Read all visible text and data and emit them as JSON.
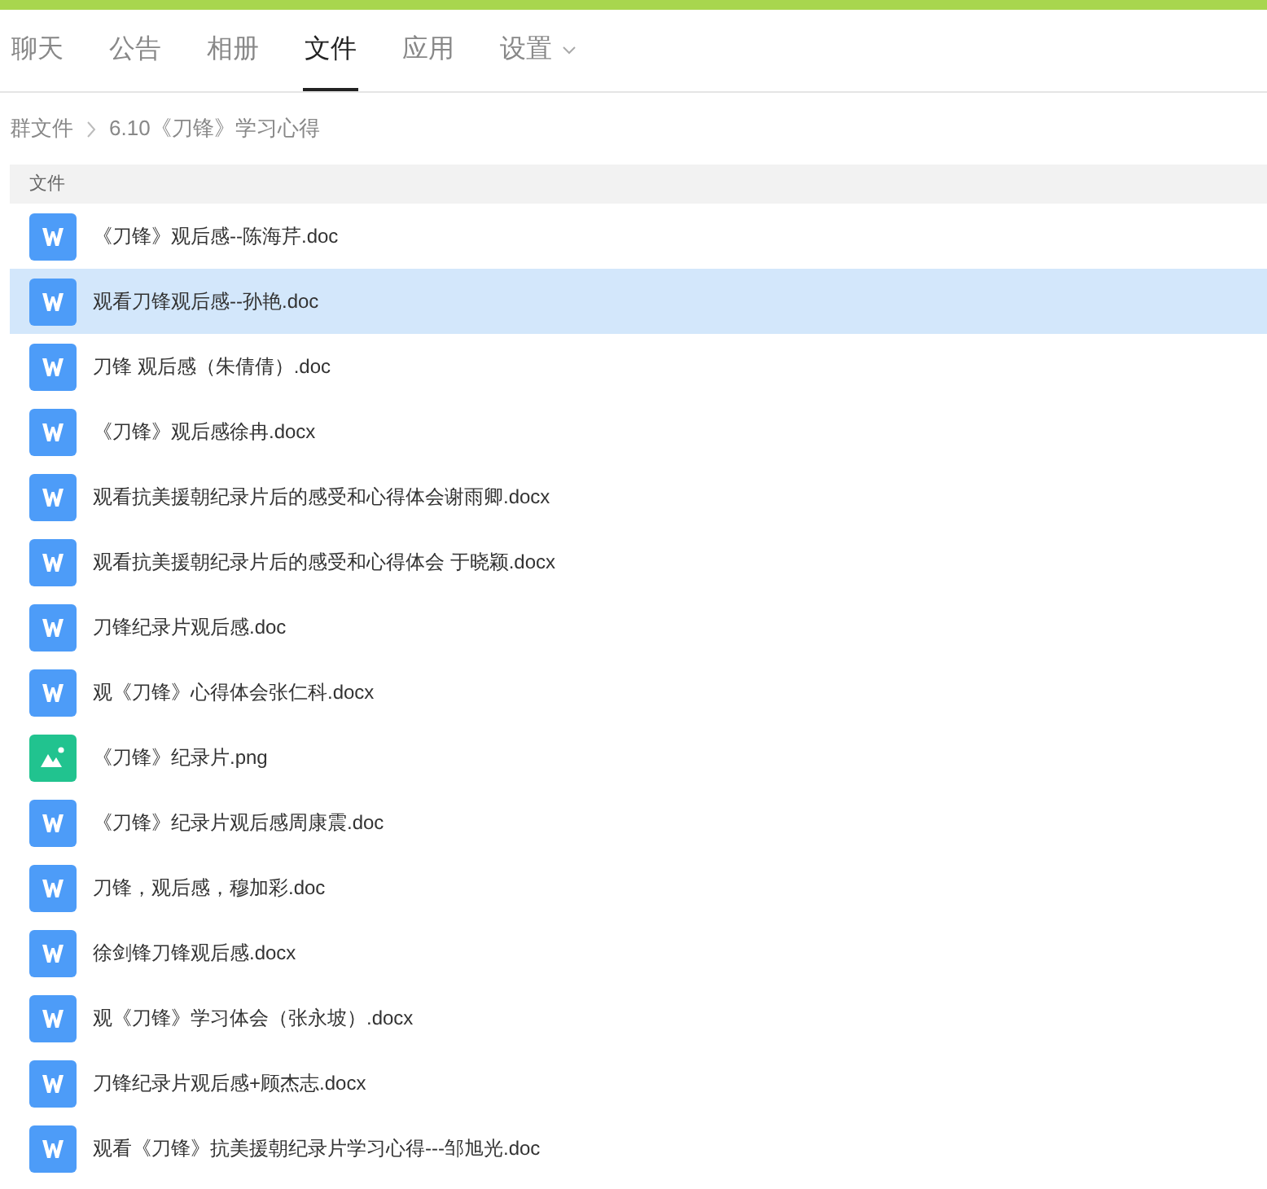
{
  "tabs": [
    {
      "label": "聊天",
      "selected": false
    },
    {
      "label": "公告",
      "selected": false
    },
    {
      "label": "相册",
      "selected": false
    },
    {
      "label": "文件",
      "selected": true
    },
    {
      "label": "应用",
      "selected": false
    },
    {
      "label": "设置",
      "selected": false,
      "has_menu": true
    }
  ],
  "breadcrumb": [
    "群文件",
    "6.10《刀锋》学习心得"
  ],
  "table": {
    "columns": [
      "文件"
    ],
    "rows": [
      {
        "kind": "doc",
        "name": "《刀锋》观后感--陈海芹.doc",
        "selected": false
      },
      {
        "kind": "doc",
        "name": "观看刀锋观后感--孙艳.doc",
        "selected": true
      },
      {
        "kind": "doc",
        "name": "刀锋 观后感（朱倩倩）.doc",
        "selected": false
      },
      {
        "kind": "doc",
        "name": "《刀锋》观后感徐冉.docx",
        "selected": false
      },
      {
        "kind": "doc",
        "name": "观看抗美援朝纪录片后的感受和心得体会谢雨卿.docx",
        "selected": false
      },
      {
        "kind": "doc",
        "name": "观看抗美援朝纪录片后的感受和心得体会 于晓颖.docx",
        "selected": false
      },
      {
        "kind": "doc",
        "name": "刀锋纪录片观后感.doc",
        "selected": false
      },
      {
        "kind": "doc",
        "name": "观《刀锋》心得体会张仁科.docx",
        "selected": false
      },
      {
        "kind": "image",
        "name": "《刀锋》纪录片.png",
        "selected": false
      },
      {
        "kind": "doc",
        "name": "《刀锋》纪录片观后感周康震.doc",
        "selected": false
      },
      {
        "kind": "doc",
        "name": "刀锋，观后感，穆加彩.doc",
        "selected": false
      },
      {
        "kind": "doc",
        "name": "徐剑锋刀锋观后感.docx",
        "selected": false
      },
      {
        "kind": "doc",
        "name": "观《刀锋》学习体会（张永坡）.docx",
        "selected": false
      },
      {
        "kind": "doc",
        "name": "刀锋纪录片观后感+顾杰志.docx",
        "selected": false
      },
      {
        "kind": "doc",
        "name": "观看《刀锋》抗美援朝纪录片学习心得---邹旭光.doc",
        "selected": false
      }
    ]
  }
}
